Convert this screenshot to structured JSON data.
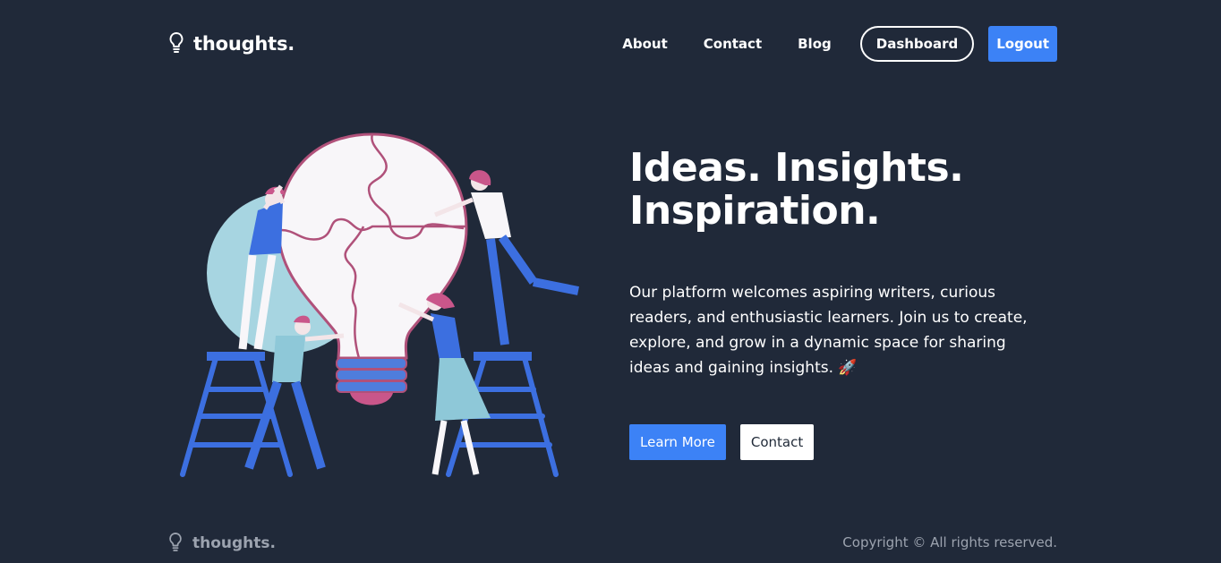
{
  "brand": {
    "name": "thoughts.",
    "icon": "lightbulb-icon"
  },
  "nav": {
    "items": [
      {
        "label": "About"
      },
      {
        "label": "Contact"
      },
      {
        "label": "Blog"
      }
    ],
    "dashboard_label": "Dashboard",
    "logout_label": "Logout"
  },
  "hero": {
    "title_line1": "Ideas. Insights.",
    "title_line2": "Inspiration.",
    "description": "Our platform welcomes aspiring writers, curious readers, and enthusiastic learners. Join us to create, explore, and grow in a dynamic space for sharing ideas and gaining insights. 🚀",
    "primary_button": "Learn More",
    "secondary_button": "Contact",
    "illustration": "people-assembling-lightbulb-puzzle-illustration"
  },
  "footer": {
    "brand": "thoughts.",
    "copyright": "Copyright © All rights reserved."
  },
  "colors": {
    "background": "#202939",
    "accent": "#3c82f6",
    "muted_text": "#9ca3af",
    "text": "#ffffff"
  }
}
